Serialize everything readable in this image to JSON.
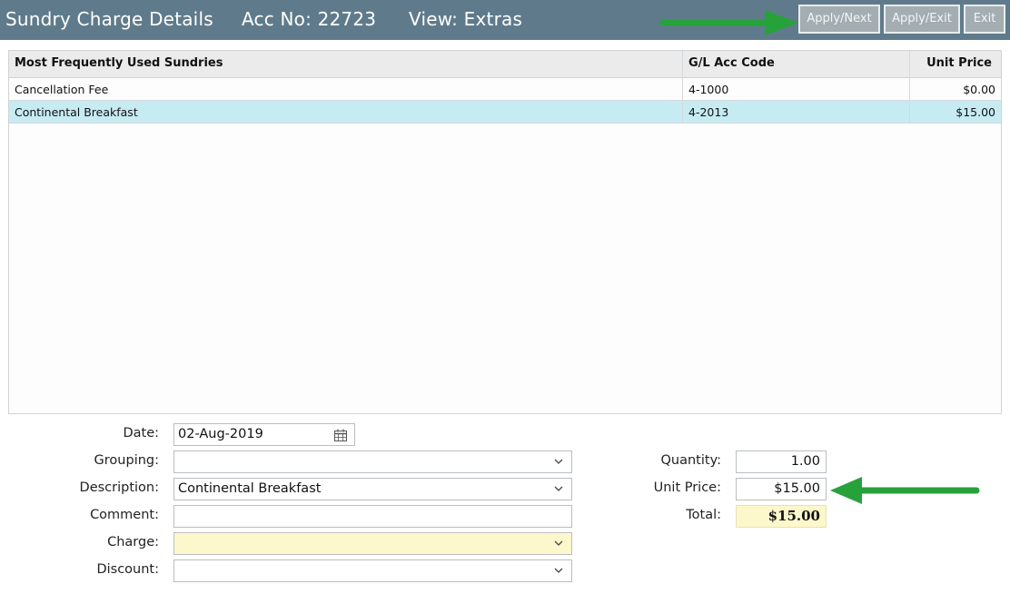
{
  "header": {
    "title": "Sundry Charge Details",
    "acc_no": "Acc No: 22723",
    "view": "View: Extras",
    "buttons": {
      "apply_next": "Apply/Next",
      "apply_exit": "Apply/Exit",
      "exit": "Exit"
    }
  },
  "grid": {
    "columns": [
      "Most Frequently Used Sundries",
      "G/L Acc Code",
      "Unit Price"
    ],
    "rows": [
      {
        "sundry": "Cancellation Fee",
        "gl_code": "4-1000",
        "unit_price": "$0.00",
        "selected": false
      },
      {
        "sundry": "Continental Breakfast",
        "gl_code": "4-2013",
        "unit_price": "$15.00",
        "selected": true
      }
    ]
  },
  "form": {
    "date_label": "Date:",
    "date_value": "02-Aug-2019",
    "grouping_label": "Grouping:",
    "grouping_value": "",
    "description_label": "Description:",
    "description_value": "Continental Breakfast",
    "comment_label": "Comment:",
    "comment_value": "",
    "charge_label": "Charge:",
    "charge_value": "",
    "discount_label": "Discount:",
    "discount_value": "",
    "quantity_label": "Quantity:",
    "quantity_value": "1.00",
    "unit_price_label": "Unit Price:",
    "unit_price_value": "$15.00",
    "total_label": "Total:",
    "total_value": "$15.00"
  },
  "colors": {
    "header_bg": "#5f7b8b",
    "selected_row": "#c7ebf3",
    "highlight_field": "#fdf7cc",
    "annotation_arrow": "#27a23b"
  },
  "icons": [
    "calendar-icon",
    "chevron-down-icon",
    "annotation-arrow"
  ]
}
